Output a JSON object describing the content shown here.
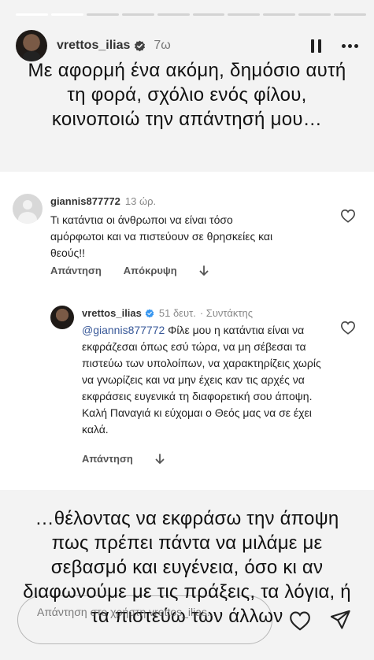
{
  "progress": {
    "segments": [
      1,
      1,
      0,
      0,
      0,
      0,
      0,
      0,
      0,
      0
    ],
    "current": 1
  },
  "header": {
    "username": "vrettos_ilias",
    "time": "7ω",
    "verified_icon": "verified-badge-icon",
    "pause_icon": "pause-icon",
    "more_icon": "more-options-icon"
  },
  "intro_text": "Με αφορμή ένα ακόμη, δημόσιο αυτή τη φορά, σχόλιο ενός φίλου, κοινοποιώ την απάντησή μου…",
  "comment1": {
    "username": "giannis877772",
    "time": "13 ώρ.",
    "text": "Τι κατάντια οι άνθρωποι να είναι τόσο αμόρφωτοι και να πιστεύουν σε θρησκείες και θεούς!!",
    "reply_label": "Απάντηση",
    "hide_label": "Απόκρυψη"
  },
  "comment2": {
    "username": "vrettos_ilias",
    "time": "51 δευτ.",
    "author_label": "· Συντάκτης",
    "mention": "@giannis877772",
    "text": " Φίλε μου η κατάντια είναι να εκφράζεσαι όπως εσύ τώρα, να μη σέβεσαι τα πιστεύω των υπολοίπων, να χαρακτηρίζεις χωρίς να γνωρίζεις και να μην έχεις καν τις αρχές να εκφράσεις ευγενικά τη διαφορετική σου άποψη. Καλή Παναγιά κι εύχομαι ο Θεός μας να σε έχει καλά.",
    "reply_label": "Απάντηση"
  },
  "outro_text": "…θέλοντας να εκφράσω την άποψη πως πρέπει πάντα να μιλάμε με σεβασμό και ευγένεια, όσο κι αν διαφωνούμε με τις πράξεις, τα λόγια, ή τα πιστεύω των άλλων",
  "reply_bar": {
    "placeholder": "Απάντηση στο χρήστη vrettos_ilias...",
    "like_icon": "heart-icon",
    "send_icon": "send-icon"
  }
}
